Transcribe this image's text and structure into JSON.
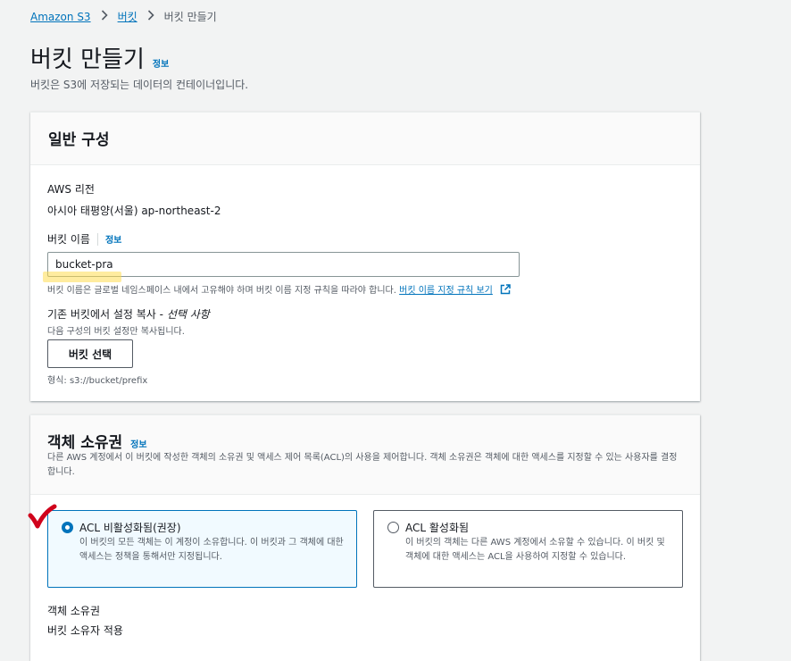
{
  "breadcrumb": {
    "items": [
      "Amazon S3",
      "버킷",
      "버킷 만들기"
    ]
  },
  "page": {
    "title": "버킷 만들기",
    "info": "정보",
    "description": "버킷은 S3에 저장되는 데이터의 컨테이너입니다."
  },
  "general": {
    "heading": "일반 구성",
    "region_label": "AWS 리전",
    "region_value": "아시아 태평양(서울) ap-northeast-2",
    "bucket_name_label": "버킷 이름",
    "bucket_name_info": "정보",
    "bucket_name_value": "bucket-pra",
    "bucket_name_hint": "버킷 이름은 글로벌 네임스페이스 내에서 고유해야 하며 버킷 이름 지정 규칙을 따라야 합니다.",
    "rules_link": "버킷 이름 지정 규칙 보기",
    "copy_label": "기존 버킷에서 설정 복사 -",
    "copy_optional": "선택 사항",
    "copy_hint": "다음 구성의 버킷 설정만 복사됩니다.",
    "choose_button": "버킷 선택",
    "format_hint": "형식: s3://bucket/prefix"
  },
  "ownership": {
    "heading": "객체 소유권",
    "info": "정보",
    "description": "다른 AWS 계정에서 이 버킷에 작성한 객체의 소유권 및 액세스 제어 목록(ACL)의 사용을 제어합니다. 객체 소유권은 객체에 대한 액세스를 지정할 수 있는 사용자를 결정합니다.",
    "option_disabled_title": "ACL 비활성화됨(권장)",
    "option_disabled_desc": "이 버킷의 모든 객체는 이 계정이 소유합니다. 이 버킷과 그 객체에 대한 액세스는 정책을 통해서만 지정됩니다.",
    "option_enabled_title": "ACL 활성화됨",
    "option_enabled_desc": "이 버킷의 객체는 다른 AWS 계정에서 소유할 수 있습니다. 이 버킷 및 객체에 대한 액세스는 ACL을 사용하여 지정할 수 있습니다.",
    "owner_label": "객체 소유권",
    "owner_value": "버킷 소유자 적용"
  },
  "colors": {
    "accent": "#0073bb",
    "checkmark": "#d0021b",
    "highlight": "#ffdc50"
  },
  "icons": [
    "chevron-right-icon",
    "external-link-icon",
    "checkmark-icon"
  ]
}
